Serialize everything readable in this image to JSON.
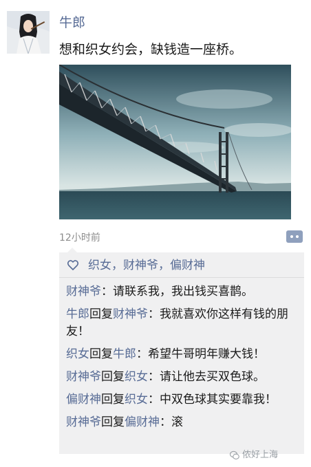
{
  "post": {
    "author": "牛郎",
    "text": "想和织女约会，缺钱造一座桥。",
    "timestamp": "12小时前"
  },
  "likes": {
    "icon": "heart-outline-icon",
    "text": "织女，财神爷，偏财神"
  },
  "comments": [
    {
      "name1": "财神爷",
      "reply": "",
      "name2": "",
      "text": "：请联系我，我出钱买喜鹊。"
    },
    {
      "name1": "牛郎",
      "reply": "回复",
      "name2": "财神爷",
      "text": "：我就喜欢你这样有钱的朋友！"
    },
    {
      "name1": "织女",
      "reply": "回复",
      "name2": "牛郎",
      "text": "：希望牛哥明年赚大钱！"
    },
    {
      "name1": "财神爷",
      "reply": "回复",
      "name2": "织女",
      "text": "：请让他去买双色球。"
    },
    {
      "name1": "偏财神",
      "reply": "回复",
      "name2": "织女",
      "text": "：中双色球其实要靠我！"
    },
    {
      "name1": "财神爷",
      "reply": "回复",
      "name2": "偏财神",
      "text": "：滚"
    }
  ],
  "watermark": {
    "text": "侬好上海",
    "icon": "wechat-icon"
  },
  "colors": {
    "name_link": "#576b95",
    "comment_bg": "#f0f0f1",
    "timestamp": "#8c8c8c"
  }
}
